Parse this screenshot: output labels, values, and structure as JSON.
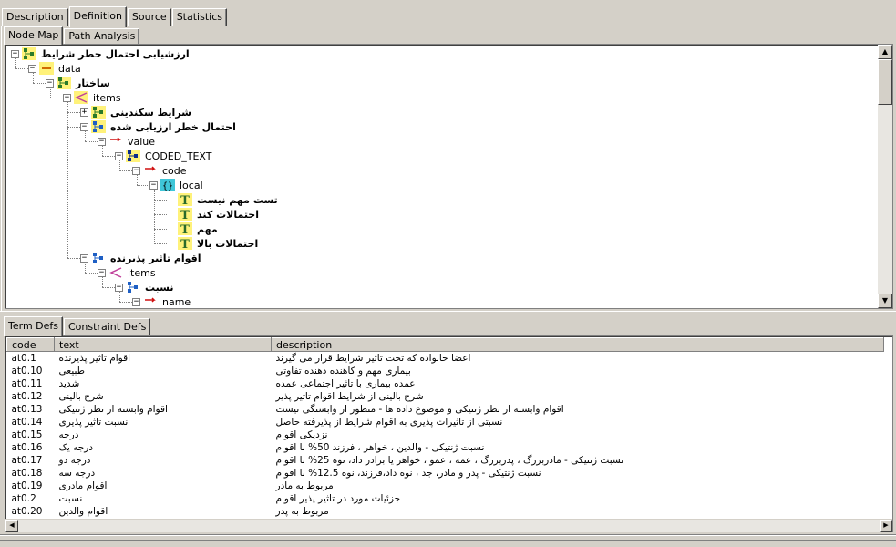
{
  "top_tabs": [
    "Description",
    "Definition",
    "Source",
    "Statistics"
  ],
  "top_tab_active": 1,
  "sub_tabs": [
    "Node Map",
    "Path Analysis"
  ],
  "bottom_tabs": [
    "Term Defs",
    "Constraint Defs"
  ],
  "tree": [
    {
      "label": "ارزشیابی احتمال خطر شرایط",
      "rtl": true,
      "depth": 0,
      "exp": "-",
      "icon": "archetype-icon",
      "color": "#2a7a2a"
    },
    {
      "label": "data",
      "rtl": false,
      "depth": 1,
      "exp": "-",
      "icon": "data-icon"
    },
    {
      "label": "ساختار",
      "rtl": true,
      "depth": 2,
      "exp": "-",
      "icon": "structure-icon",
      "color": "#2a7a2a"
    },
    {
      "label": "items",
      "rtl": false,
      "depth": 3,
      "exp": "-",
      "icon": "items-icon"
    },
    {
      "label": "شرایط سکندینی",
      "rtl": true,
      "depth": 4,
      "exp": "+",
      "icon": "cluster-icon",
      "color": "#2a7a2a"
    },
    {
      "label": "احتمال خطر ارزیابی شده",
      "rtl": true,
      "depth": 4,
      "exp": "-",
      "icon": "element-icon",
      "color": "#1e5fc4"
    },
    {
      "label": "value",
      "rtl": false,
      "depth": 5,
      "exp": "-",
      "icon": "attribute-icon"
    },
    {
      "label": "CODED_TEXT",
      "rtl": false,
      "depth": 6,
      "exp": "-",
      "icon": "coded-text-icon"
    },
    {
      "label": "code",
      "rtl": false,
      "depth": 7,
      "exp": "-",
      "icon": "attribute-icon"
    },
    {
      "label": "local",
      "rtl": false,
      "depth": 8,
      "exp": "-",
      "icon": "local-codes-icon"
    },
    {
      "label": "تست مهم نیست",
      "rtl": true,
      "depth": 9,
      "exp": "",
      "icon": "term-icon"
    },
    {
      "label": "احتمالات کند",
      "rtl": true,
      "depth": 9,
      "exp": "",
      "icon": "term-icon"
    },
    {
      "label": "مهم",
      "rtl": true,
      "depth": 9,
      "exp": "",
      "icon": "term-icon"
    },
    {
      "label": "احتمالات بالا",
      "rtl": true,
      "depth": 9,
      "exp": "",
      "icon": "term-icon"
    },
    {
      "label": "اقوام تاثیر پذیرنده",
      "rtl": true,
      "depth": 4,
      "exp": "-",
      "icon": "cluster-icon2",
      "color": "#1e5fc4"
    },
    {
      "label": "items",
      "rtl": false,
      "depth": 5,
      "exp": "-",
      "icon": "items-icon2"
    },
    {
      "label": "نسبت",
      "rtl": true,
      "depth": 6,
      "exp": "-",
      "icon": "element-icon2",
      "color": "#1e5fc4"
    },
    {
      "label": "name",
      "rtl": false,
      "depth": 7,
      "exp": "-",
      "icon": "attribute-icon"
    }
  ],
  "term_defs": {
    "columns": [
      "code",
      "text",
      "description"
    ],
    "rows": [
      {
        "code": "at0.1",
        "text": "اقوام تاثیر پذیرنده",
        "description": "اعضا خانواده که تحت تاثیر شرایط قرار می گیرند"
      },
      {
        "code": "at0.10",
        "text": "طبیعی",
        "description": "بیماری مهم و کاهنده دهنده تفاوتی"
      },
      {
        "code": "at0.11",
        "text": "شدید",
        "description": "عمده بیماری با تاثیر اجتماعی عمده"
      },
      {
        "code": "at0.12",
        "text": "شرح بالینی",
        "description": "شرح بالینی از شرایط اقوام تاثیر پذیر"
      },
      {
        "code": "at0.13",
        "text": "اقوام وابسته از نظر ژنتیکی",
        "description": "اقوام وابسته از نظر ژنتیکی و موضوع داده ها - منظور از وابستگی نیست"
      },
      {
        "code": "at0.14",
        "text": "نسبت تاثیر پذیری",
        "description": "نسبتی از تاثیرات پذیری به اقوام شرایط از پذیرفته حاصل"
      },
      {
        "code": "at0.15",
        "text": "درجه",
        "description": "نزدیکی اقوام"
      },
      {
        "code": "at0.16",
        "text": "درجه یک",
        "description": "نسبت ژنتیکی - والدین ، خواهر ، فرزند 50% با اقوام"
      },
      {
        "code": "at0.17",
        "text": "درجه دو",
        "description": "نسبت ژنتیکی - مادربزرگ ، پدربزرگ ، عمه ، عمو ، خواهر یا برادر داد، نوه 25% با اقوام"
      },
      {
        "code": "at0.18",
        "text": "درجه سه",
        "description": "نسبت ژنتیکی - پدر و مادر، جد ، نوه داد،فرزند، نوه 12.5% با اقوام"
      },
      {
        "code": "at0.19",
        "text": "اقوام مادری",
        "description": "مربوط به مادر"
      },
      {
        "code": "at0.2",
        "text": "نسبت",
        "description": "جزئیات مورد در تاثیر پذیر اقوام"
      },
      {
        "code": "at0.20",
        "text": "اقوام والدین",
        "description": "مربوط به پدر"
      }
    ]
  },
  "colors": {
    "face": "#d4d0c8",
    "window": "#ffffff",
    "tree_icon_yellow": "#fff27a"
  }
}
